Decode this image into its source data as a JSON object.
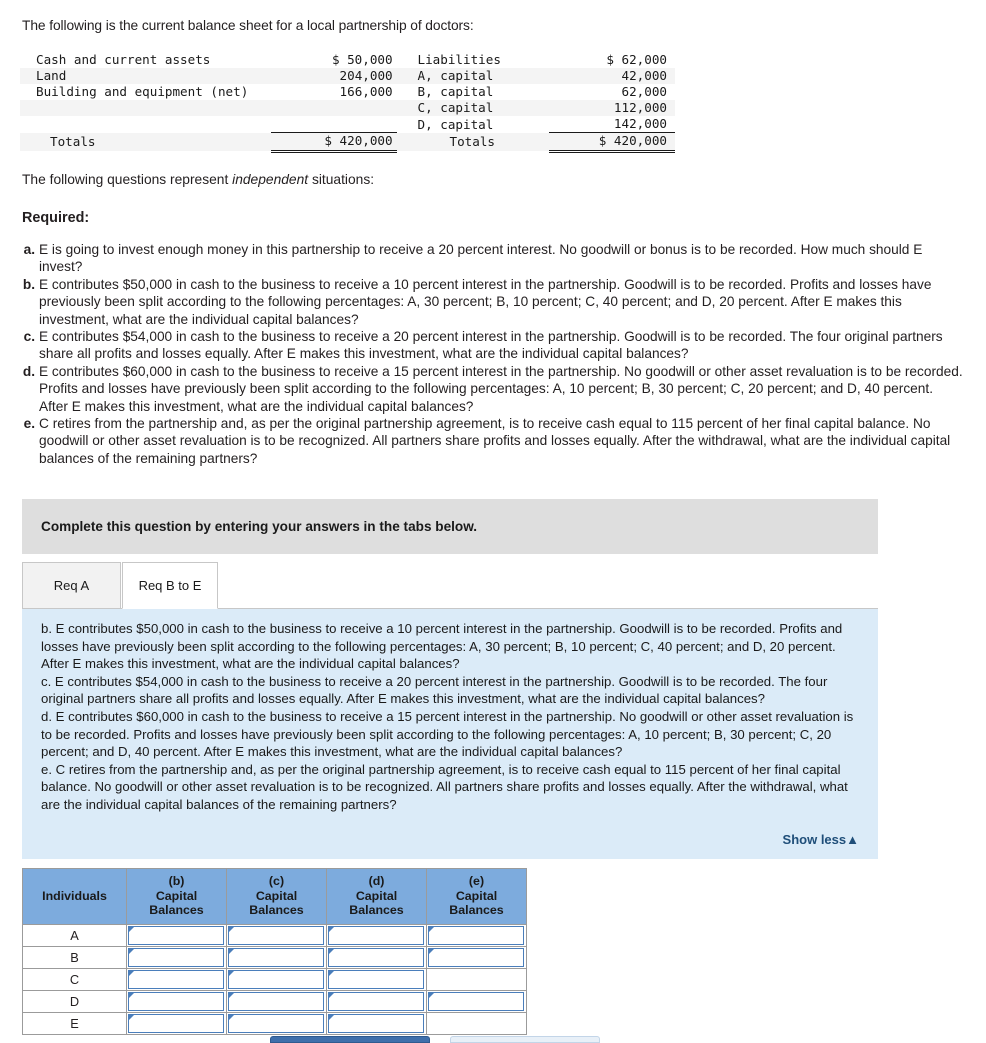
{
  "intro": "The following is the current balance sheet for a local partnership of doctors:",
  "balance_sheet": {
    "rows": [
      {
        "left_label": "Cash and current assets",
        "left_amount": "$ 50,000",
        "right_label": "Liabilities",
        "right_amount": "$ 62,000"
      },
      {
        "left_label": "Land",
        "left_amount": "204,000",
        "right_label": "A, capital",
        "right_amount": "42,000"
      },
      {
        "left_label": "Building and equipment (net)",
        "left_amount": "166,000",
        "right_label": "B, capital",
        "right_amount": "62,000"
      },
      {
        "left_label": "",
        "left_amount": "",
        "right_label": "C, capital",
        "right_amount": "112,000"
      },
      {
        "left_label": "",
        "left_amount": "",
        "right_label": "D, capital",
        "right_amount": "142,000"
      }
    ],
    "totals": {
      "left_label": "Totals",
      "left_amount": "$ 420,000",
      "right_label": "Totals",
      "right_amount": "$ 420,000"
    }
  },
  "questions_lead_before": "The following questions represent ",
  "questions_lead_italic": "independent",
  "questions_lead_after": " situations:",
  "required_heading": "Required:",
  "required_items": [
    {
      "letter": "a.",
      "text": "E is going to invest enough money in this partnership to receive a 20 percent interest. No goodwill or bonus is to be recorded. How much should E invest?"
    },
    {
      "letter": "b.",
      "text": "E contributes $50,000 in cash to the business to receive a 10 percent interest in the partnership. Goodwill is to be recorded. Profits and losses have previously been split according to the following percentages: A, 30 percent; B, 10 percent; C, 40 percent; and D, 20 percent. After E makes this investment, what are the individual capital balances?"
    },
    {
      "letter": "c.",
      "text": "E contributes $54,000 in cash to the business to receive a 20 percent interest in the partnership. Goodwill is to be recorded. The four original partners share all profits and losses equally. After E makes this investment, what are the individual capital balances?"
    },
    {
      "letter": "d.",
      "text": "E contributes $60,000 in cash to the business to receive a 15 percent interest in the partnership. No goodwill or other asset revaluation is to be recorded. Profits and losses have previously been split according to the following percentages: A, 10 percent; B, 30 percent; C, 20 percent; and D, 40 percent. After E makes this investment, what are the individual capital balances?"
    },
    {
      "letter": "e.",
      "text": "C retires from the partnership and, as per the original partnership agreement, is to receive cash equal to 115 percent of her final capital balance. No goodwill or other asset revaluation is to be recognized. All partners share profits and losses equally. After the withdrawal, what are the individual capital balances of the remaining partners?"
    }
  ],
  "banner_text": "Complete this question by entering your answers in the tabs below.",
  "tabs": [
    {
      "label": "Req A",
      "active": false
    },
    {
      "label": "Req B to E",
      "active": true
    }
  ],
  "panel": {
    "paragraphs": [
      "b. E contributes $50,000 in cash to the business to receive a 10 percent interest in the partnership. Goodwill is to be recorded. Profits and losses have previously been split according to the following percentages: A, 30 percent; B, 10 percent; C, 40 percent; and D, 20 percent. After E makes this investment, what are the individual capital balances?",
      "c. E contributes $54,000 in cash to the business to receive a 20 percent interest in the partnership. Goodwill is to be recorded. The four original partners share all profits and losses equally. After E makes this investment, what are the individual capital balances?",
      "d. E contributes $60,000 in cash to the business to receive a 15 percent interest in the partnership. No goodwill or other asset revaluation is to be recorded. Profits and losses have previously been split according to the following percentages: A, 10 percent; B, 30 percent; C, 20 percent; and D, 40 percent. After E makes this investment, what are the individual capital balances?",
      "e. C retires from the partnership and, as per the original partnership agreement, is to receive cash equal to 115 percent of her final capital balance. No goodwill or other asset revaluation is to be recognized. All partners share profits and losses equally. After the withdrawal, what are the individual capital balances of the remaining partners?"
    ],
    "show_less_label": "Show less▲"
  },
  "answer_table": {
    "headers": [
      {
        "top": "",
        "mid": "Individuals",
        "bot": ""
      },
      {
        "top": "(b)",
        "mid": "Capital",
        "bot": "Balances"
      },
      {
        "top": "(c)",
        "mid": "Capital",
        "bot": "Balances"
      },
      {
        "top": "(d)",
        "mid": "Capital",
        "bot": "Balances"
      },
      {
        "top": "(e)",
        "mid": "Capital",
        "bot": "Balances"
      }
    ],
    "rows": [
      {
        "label": "A",
        "cells": [
          "input",
          "input",
          "input",
          "input"
        ],
        "values": [
          "",
          "",
          "",
          ""
        ]
      },
      {
        "label": "B",
        "cells": [
          "input",
          "input",
          "input",
          "input"
        ],
        "values": [
          "",
          "",
          "",
          ""
        ]
      },
      {
        "label": "C",
        "cells": [
          "input",
          "input",
          "input",
          "blank"
        ],
        "values": [
          "",
          "",
          "",
          ""
        ]
      },
      {
        "label": "D",
        "cells": [
          "input",
          "input",
          "input",
          "input"
        ],
        "values": [
          "",
          "",
          "",
          ""
        ]
      },
      {
        "label": "E",
        "cells": [
          "input",
          "input",
          "input",
          "blank"
        ],
        "values": [
          "",
          "",
          "",
          ""
        ]
      }
    ]
  },
  "colors": {
    "header_blue": "#7dabdd",
    "panel_blue": "#dbebf8",
    "banner_grey": "#dedede",
    "link_blue": "#1f4e79",
    "input_border": "#4a7ebb"
  }
}
